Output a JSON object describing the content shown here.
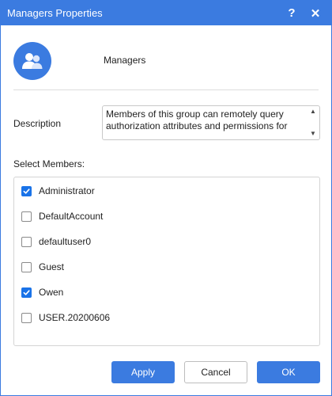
{
  "window": {
    "title": "Managers Properties",
    "help_label": "?",
    "close_label": "✕"
  },
  "group": {
    "name": "Managers"
  },
  "description": {
    "label": "Description",
    "value": "Members of this group can remotely query authorization attributes and permissions for"
  },
  "members": {
    "label": "Select Members:",
    "items": [
      {
        "label": "Administrator",
        "checked": true
      },
      {
        "label": "DefaultAccount",
        "checked": false
      },
      {
        "label": "defaultuser0",
        "checked": false
      },
      {
        "label": "Guest",
        "checked": false
      },
      {
        "label": "Owen",
        "checked": true
      },
      {
        "label": "USER.20200606",
        "checked": false
      }
    ]
  },
  "buttons": {
    "apply": "Apply",
    "cancel": "Cancel",
    "ok": "OK"
  },
  "colors": {
    "accent": "#3b7be0",
    "check": "#1a73e8"
  }
}
